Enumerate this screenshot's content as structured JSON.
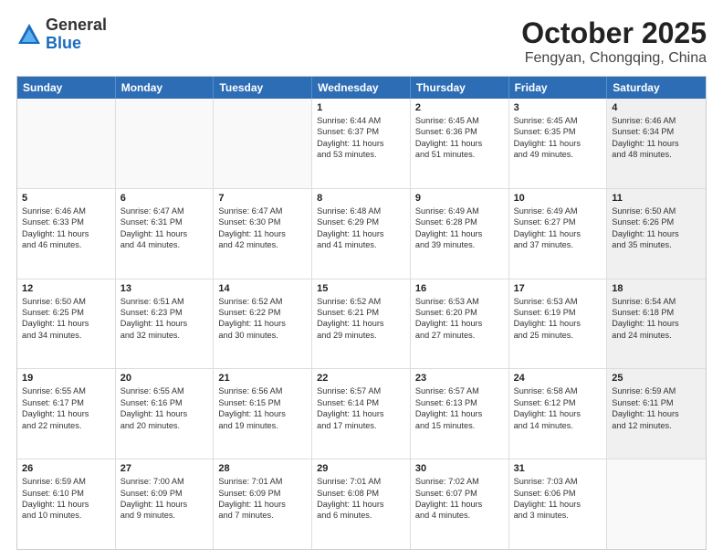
{
  "header": {
    "logo": {
      "general": "General",
      "blue": "Blue"
    },
    "title": "October 2025",
    "location": "Fengyan, Chongqing, China"
  },
  "calendar": {
    "weekdays": [
      "Sunday",
      "Monday",
      "Tuesday",
      "Wednesday",
      "Thursday",
      "Friday",
      "Saturday"
    ],
    "rows": [
      [
        {
          "day": "",
          "info": "",
          "empty": true
        },
        {
          "day": "",
          "info": "",
          "empty": true
        },
        {
          "day": "",
          "info": "",
          "empty": true
        },
        {
          "day": "1",
          "info": "Sunrise: 6:44 AM\nSunset: 6:37 PM\nDaylight: 11 hours\nand 53 minutes."
        },
        {
          "day": "2",
          "info": "Sunrise: 6:45 AM\nSunset: 6:36 PM\nDaylight: 11 hours\nand 51 minutes."
        },
        {
          "day": "3",
          "info": "Sunrise: 6:45 AM\nSunset: 6:35 PM\nDaylight: 11 hours\nand 49 minutes."
        },
        {
          "day": "4",
          "info": "Sunrise: 6:46 AM\nSunset: 6:34 PM\nDaylight: 11 hours\nand 48 minutes.",
          "shaded": true
        }
      ],
      [
        {
          "day": "5",
          "info": "Sunrise: 6:46 AM\nSunset: 6:33 PM\nDaylight: 11 hours\nand 46 minutes."
        },
        {
          "day": "6",
          "info": "Sunrise: 6:47 AM\nSunset: 6:31 PM\nDaylight: 11 hours\nand 44 minutes."
        },
        {
          "day": "7",
          "info": "Sunrise: 6:47 AM\nSunset: 6:30 PM\nDaylight: 11 hours\nand 42 minutes."
        },
        {
          "day": "8",
          "info": "Sunrise: 6:48 AM\nSunset: 6:29 PM\nDaylight: 11 hours\nand 41 minutes."
        },
        {
          "day": "9",
          "info": "Sunrise: 6:49 AM\nSunset: 6:28 PM\nDaylight: 11 hours\nand 39 minutes."
        },
        {
          "day": "10",
          "info": "Sunrise: 6:49 AM\nSunset: 6:27 PM\nDaylight: 11 hours\nand 37 minutes."
        },
        {
          "day": "11",
          "info": "Sunrise: 6:50 AM\nSunset: 6:26 PM\nDaylight: 11 hours\nand 35 minutes.",
          "shaded": true
        }
      ],
      [
        {
          "day": "12",
          "info": "Sunrise: 6:50 AM\nSunset: 6:25 PM\nDaylight: 11 hours\nand 34 minutes."
        },
        {
          "day": "13",
          "info": "Sunrise: 6:51 AM\nSunset: 6:23 PM\nDaylight: 11 hours\nand 32 minutes."
        },
        {
          "day": "14",
          "info": "Sunrise: 6:52 AM\nSunset: 6:22 PM\nDaylight: 11 hours\nand 30 minutes."
        },
        {
          "day": "15",
          "info": "Sunrise: 6:52 AM\nSunset: 6:21 PM\nDaylight: 11 hours\nand 29 minutes."
        },
        {
          "day": "16",
          "info": "Sunrise: 6:53 AM\nSunset: 6:20 PM\nDaylight: 11 hours\nand 27 minutes."
        },
        {
          "day": "17",
          "info": "Sunrise: 6:53 AM\nSunset: 6:19 PM\nDaylight: 11 hours\nand 25 minutes."
        },
        {
          "day": "18",
          "info": "Sunrise: 6:54 AM\nSunset: 6:18 PM\nDaylight: 11 hours\nand 24 minutes.",
          "shaded": true
        }
      ],
      [
        {
          "day": "19",
          "info": "Sunrise: 6:55 AM\nSunset: 6:17 PM\nDaylight: 11 hours\nand 22 minutes."
        },
        {
          "day": "20",
          "info": "Sunrise: 6:55 AM\nSunset: 6:16 PM\nDaylight: 11 hours\nand 20 minutes."
        },
        {
          "day": "21",
          "info": "Sunrise: 6:56 AM\nSunset: 6:15 PM\nDaylight: 11 hours\nand 19 minutes."
        },
        {
          "day": "22",
          "info": "Sunrise: 6:57 AM\nSunset: 6:14 PM\nDaylight: 11 hours\nand 17 minutes."
        },
        {
          "day": "23",
          "info": "Sunrise: 6:57 AM\nSunset: 6:13 PM\nDaylight: 11 hours\nand 15 minutes."
        },
        {
          "day": "24",
          "info": "Sunrise: 6:58 AM\nSunset: 6:12 PM\nDaylight: 11 hours\nand 14 minutes."
        },
        {
          "day": "25",
          "info": "Sunrise: 6:59 AM\nSunset: 6:11 PM\nDaylight: 11 hours\nand 12 minutes.",
          "shaded": true
        }
      ],
      [
        {
          "day": "26",
          "info": "Sunrise: 6:59 AM\nSunset: 6:10 PM\nDaylight: 11 hours\nand 10 minutes."
        },
        {
          "day": "27",
          "info": "Sunrise: 7:00 AM\nSunset: 6:09 PM\nDaylight: 11 hours\nand 9 minutes."
        },
        {
          "day": "28",
          "info": "Sunrise: 7:01 AM\nSunset: 6:09 PM\nDaylight: 11 hours\nand 7 minutes."
        },
        {
          "day": "29",
          "info": "Sunrise: 7:01 AM\nSunset: 6:08 PM\nDaylight: 11 hours\nand 6 minutes."
        },
        {
          "day": "30",
          "info": "Sunrise: 7:02 AM\nSunset: 6:07 PM\nDaylight: 11 hours\nand 4 minutes."
        },
        {
          "day": "31",
          "info": "Sunrise: 7:03 AM\nSunset: 6:06 PM\nDaylight: 11 hours\nand 3 minutes."
        },
        {
          "day": "",
          "info": "",
          "empty": true,
          "shaded": true
        }
      ]
    ]
  }
}
